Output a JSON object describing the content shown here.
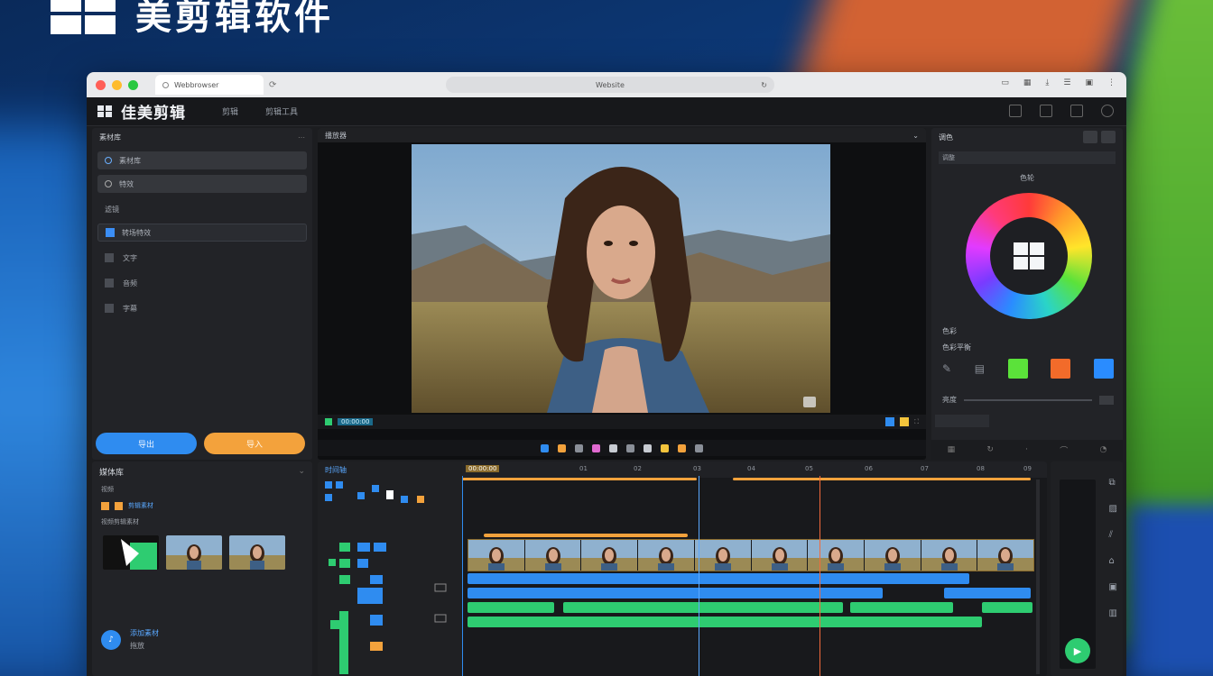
{
  "hero": {
    "title": "美剪辑软件"
  },
  "browser": {
    "tab_title": "Webbrowser",
    "address": "Website",
    "refresh_icon": "refresh-icon"
  },
  "app": {
    "title": "佳美剪辑",
    "menu": [
      "剪辑",
      "剪辑工具"
    ]
  },
  "left_panel": {
    "header": "素材库",
    "items": [
      {
        "label": "素材库",
        "selected": true
      },
      {
        "label": "特效"
      },
      {
        "label": "滤镜"
      },
      {
        "label": "转场特效"
      },
      {
        "label": "文字"
      },
      {
        "label": "音频"
      },
      {
        "label": "字幕"
      }
    ],
    "btn_primary": "导出",
    "btn_secondary": "导入"
  },
  "viewer": {
    "header": "播放器",
    "time": "00:00:00"
  },
  "right_panel": {
    "header": "调色",
    "field": "调整",
    "wheel_label": "色轮",
    "label_1": "色彩",
    "label_2": "色彩平衡",
    "value_box": "",
    "slider_label": "亮度",
    "slider_value": "",
    "swatches": [
      "#5be23a",
      "#f26b2a",
      "#2a8cff"
    ]
  },
  "media_panel": {
    "header": "媒体库",
    "rows": [
      "视频",
      "剪辑素材",
      "视频剪辑素材"
    ],
    "foot_title": "添加素材",
    "foot_sub": "拖放"
  },
  "timeline": {
    "header": "时间轴",
    "ruler": [
      "00:00:00",
      "01",
      "02",
      "03",
      "04",
      "05",
      "06",
      "07",
      "08",
      "09"
    ]
  },
  "colors": {
    "accent_blue": "#2f8cf0",
    "accent_orange": "#f3a23c",
    "accent_green": "#2ecc71"
  }
}
